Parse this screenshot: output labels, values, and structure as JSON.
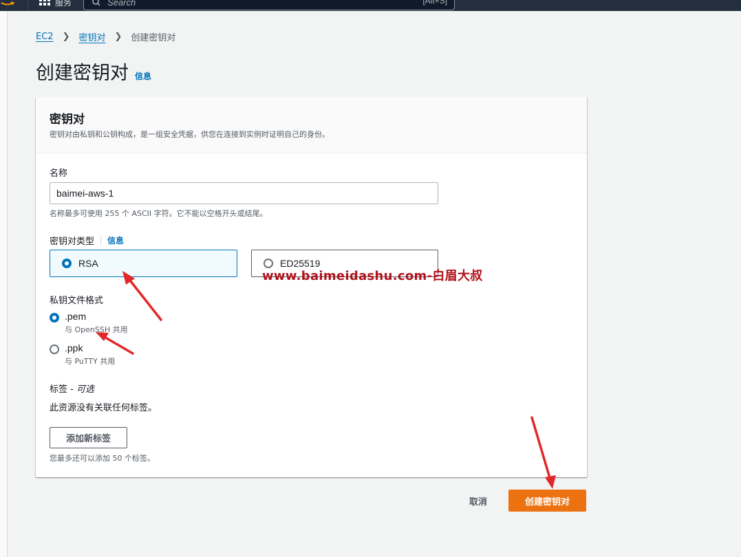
{
  "topbar": {
    "services_label": "服务",
    "search_placeholder": "Search",
    "search_shortcut": "[Alt+S]"
  },
  "breadcrumb": {
    "items": [
      "EC2",
      "密钥对"
    ],
    "current": "创建密钥对"
  },
  "page": {
    "title": "创建密钥对",
    "info_link": "信息"
  },
  "panel": {
    "title": "密钥对",
    "description": "密钥对由私钥和公钥构成，是一组安全凭据，供您在连接到实例时证明自己的身份。",
    "name": {
      "label": "名称",
      "value": "baimei-aws-1",
      "hint": "名称最多可使用 255 个 ASCII 字符。它不能以空格开头或结尾。"
    },
    "key_type": {
      "label": "密钥对类型",
      "info_link": "信息",
      "options": [
        {
          "label": "RSA",
          "selected": true
        },
        {
          "label": "ED25519",
          "selected": false
        }
      ]
    },
    "file_format": {
      "label": "私钥文件格式",
      "options": [
        {
          "label": ".pem",
          "sub": "与 OpenSSH 共用",
          "selected": true
        },
        {
          "label": ".ppk",
          "sub": "与 PuTTY 共用",
          "selected": false
        }
      ]
    },
    "tags": {
      "label": "标签 - ",
      "optional": "可选",
      "empty_text": "此资源没有关联任何标签。",
      "add_button": "添加新标签",
      "limit_hint": "您最多还可以添加 50 个标签。"
    }
  },
  "footer": {
    "cancel": "取消",
    "create": "创建密钥对"
  },
  "watermark": "www.baimeidashu.com-白眉大叔",
  "colors": {
    "accent": "#0073bb",
    "primary_button": "#ec7211",
    "annotation": "#e22828",
    "topbar": "#232f3e"
  }
}
